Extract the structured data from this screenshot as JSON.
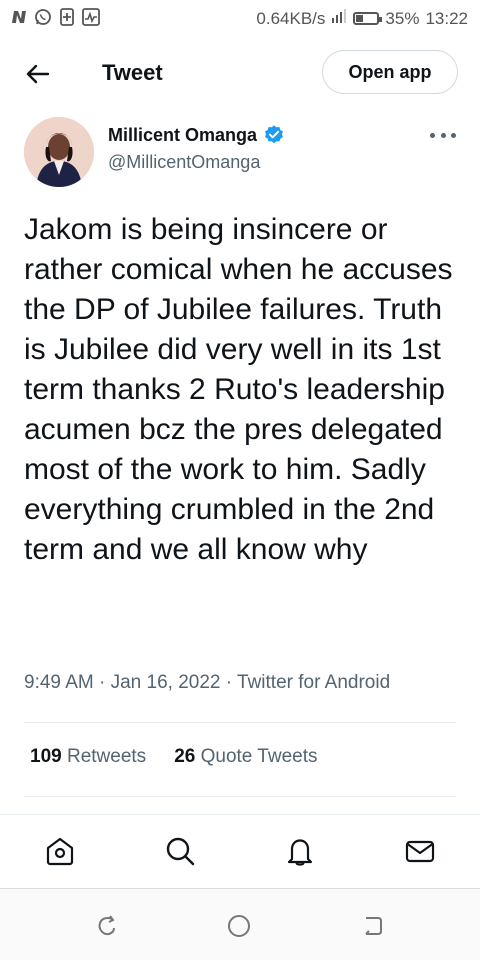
{
  "status_bar": {
    "net_speed": "0.64KB/s",
    "battery_percent": "35%",
    "battery_level": 0.35,
    "time": "13:22",
    "left_icons": [
      "n-icon",
      "whatsapp-icon",
      "sim-icon",
      "activity-icon"
    ],
    "right_icons": [
      "signal-icon",
      "battery-icon"
    ]
  },
  "header": {
    "back_icon": "arrow-left-icon",
    "title": "Tweet",
    "open_app_label": "Open app"
  },
  "author": {
    "name": "Millicent Omanga",
    "handle": "@MillicentOmanga",
    "verified_icon": "verified-badge-icon",
    "more_icon": "more-horizontal-icon"
  },
  "tweet": {
    "text": "Jakom is being insincere or rather comical when he accuses the DP of Jubilee failures. Truth is Jubilee did very well in its 1st term thanks 2 Ruto's leadership acumen bcz the pres delegated most of the work to him. Sadly everything crumbled in the 2nd term and we all know why",
    "meta": "9:49 AM · Jan 16, 2022 · Twitter for Android"
  },
  "stats": {
    "retweets_count": "109",
    "retweets_label": "Retweets",
    "quotes_count": "26",
    "quotes_label": "Quote Tweets"
  },
  "tabbar": {
    "icons": [
      "home-icon",
      "search-icon",
      "notifications-icon",
      "messages-icon"
    ]
  },
  "android_nav": {
    "icons": [
      "recents-icon",
      "home-circle-icon",
      "back-icon"
    ]
  },
  "colors": {
    "verified_blue": "#1d9bf0",
    "secondary_text": "#536471",
    "primary_text": "#0f1419"
  }
}
